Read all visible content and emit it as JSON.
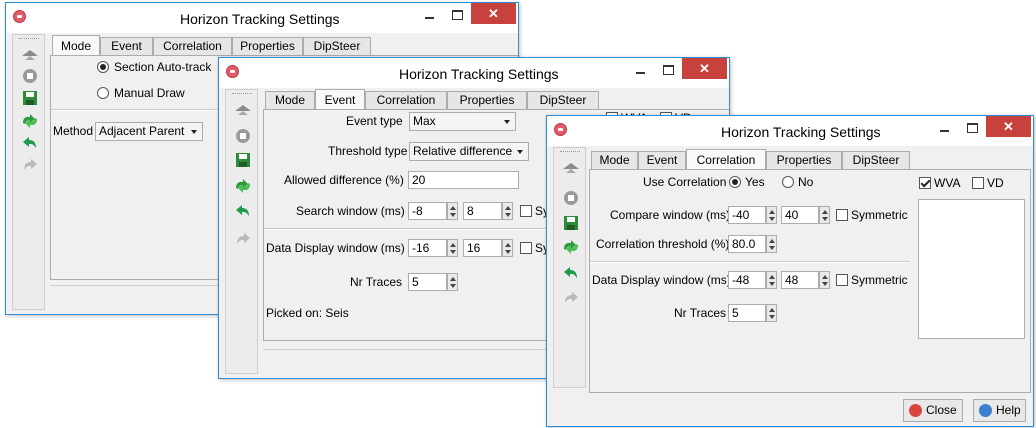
{
  "icons": {
    "app": "app-icon",
    "track": "track-icon",
    "stop": "stop-icon",
    "save": "save-icon",
    "retrack": "retrack-icon",
    "undo": "undo-icon",
    "redo": "redo-icon"
  },
  "colors": {
    "close_button": "#c7413d",
    "window_border": "#2a8fd8",
    "accent_green": "#2e9b3a"
  },
  "win1": {
    "title": "Horizon Tracking Settings",
    "tabs": [
      "Mode",
      "Event",
      "Correlation",
      "Properties",
      "DipSteer"
    ],
    "selected_tab": "Mode",
    "section_autotrack": "Section Auto-track",
    "manual_draw": "Manual Draw",
    "method_label": "Method",
    "method_value": "Adjacent Parent"
  },
  "win2": {
    "title": "Horizon Tracking Settings",
    "tabs": [
      "Mode",
      "Event",
      "Correlation",
      "Properties",
      "DipSteer"
    ],
    "selected_tab": "Event",
    "event_type_label": "Event type",
    "event_type_value": "Max",
    "threshold_type_label": "Threshold type",
    "threshold_type_value": "Relative difference",
    "allowed_diff_label": "Allowed difference (%)",
    "allowed_diff_value": "20",
    "search_window_label": "Search window (ms)",
    "search_min": "-8",
    "search_max": "8",
    "symmetric_partial": "Sy",
    "data_display_label": "Data Display window (ms)",
    "display_min": "-16",
    "display_max": "16",
    "nr_traces_label": "Nr Traces",
    "nr_traces_value": "5",
    "picked_on": "Picked on: Seis",
    "wva_label": "WVA",
    "vd_label": "VD"
  },
  "win3": {
    "title": "Horizon Tracking Settings",
    "tabs": [
      "Mode",
      "Event",
      "Correlation",
      "Properties",
      "DipSteer"
    ],
    "selected_tab": "Correlation",
    "use_correlation_label": "Use Correlation",
    "yes_label": "Yes",
    "no_label": "No",
    "compare_window_label": "Compare window (ms)",
    "compare_min": "-40",
    "compare_max": "40",
    "symmetric_label": "Symmetric",
    "corr_threshold_label": "Correlation threshold (%)",
    "corr_threshold_value": "80.0",
    "data_display_label": "Data Display window (ms)",
    "display_min": "-48",
    "display_max": "48",
    "nr_traces_label": "Nr Traces",
    "nr_traces_value": "5",
    "wva_label": "WVA",
    "vd_label": "VD",
    "close_label": "Close",
    "help_label": "Help"
  }
}
